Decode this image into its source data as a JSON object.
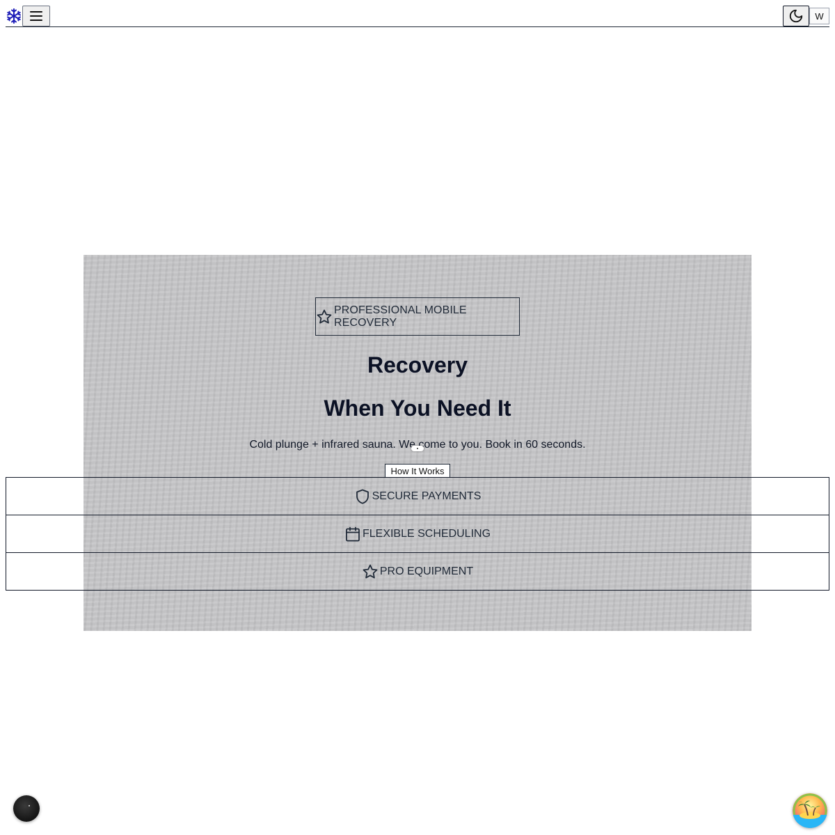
{
  "header": {
    "logo_icon": "snowflake-icon",
    "menu_icon": "hamburger-menu-icon",
    "theme_icon": "moon-icon",
    "language_label": "W"
  },
  "hero": {
    "badge_icon": "star-icon",
    "badge_label": "PROFESSIONAL MOBILE RECOVERY",
    "title_line1": "Recovery",
    "title_line2": "When You Need It",
    "subtitle": "Cold plunge + infrared sauna. We come to you. Book in 60 seconds.",
    "how_it_works_label": "How It Works"
  },
  "features": [
    {
      "icon": "shield-icon",
      "label": "SECURE PAYMENTS"
    },
    {
      "icon": "calendar-icon",
      "label": "FLEXIBLE SCHEDULING"
    },
    {
      "icon": "star-icon",
      "label": "PRO EQUIPMENT"
    }
  ],
  "colors": {
    "logo": "#1d1db8",
    "hero_background": "#c6c6c8",
    "text_dark": "#0b1124"
  }
}
